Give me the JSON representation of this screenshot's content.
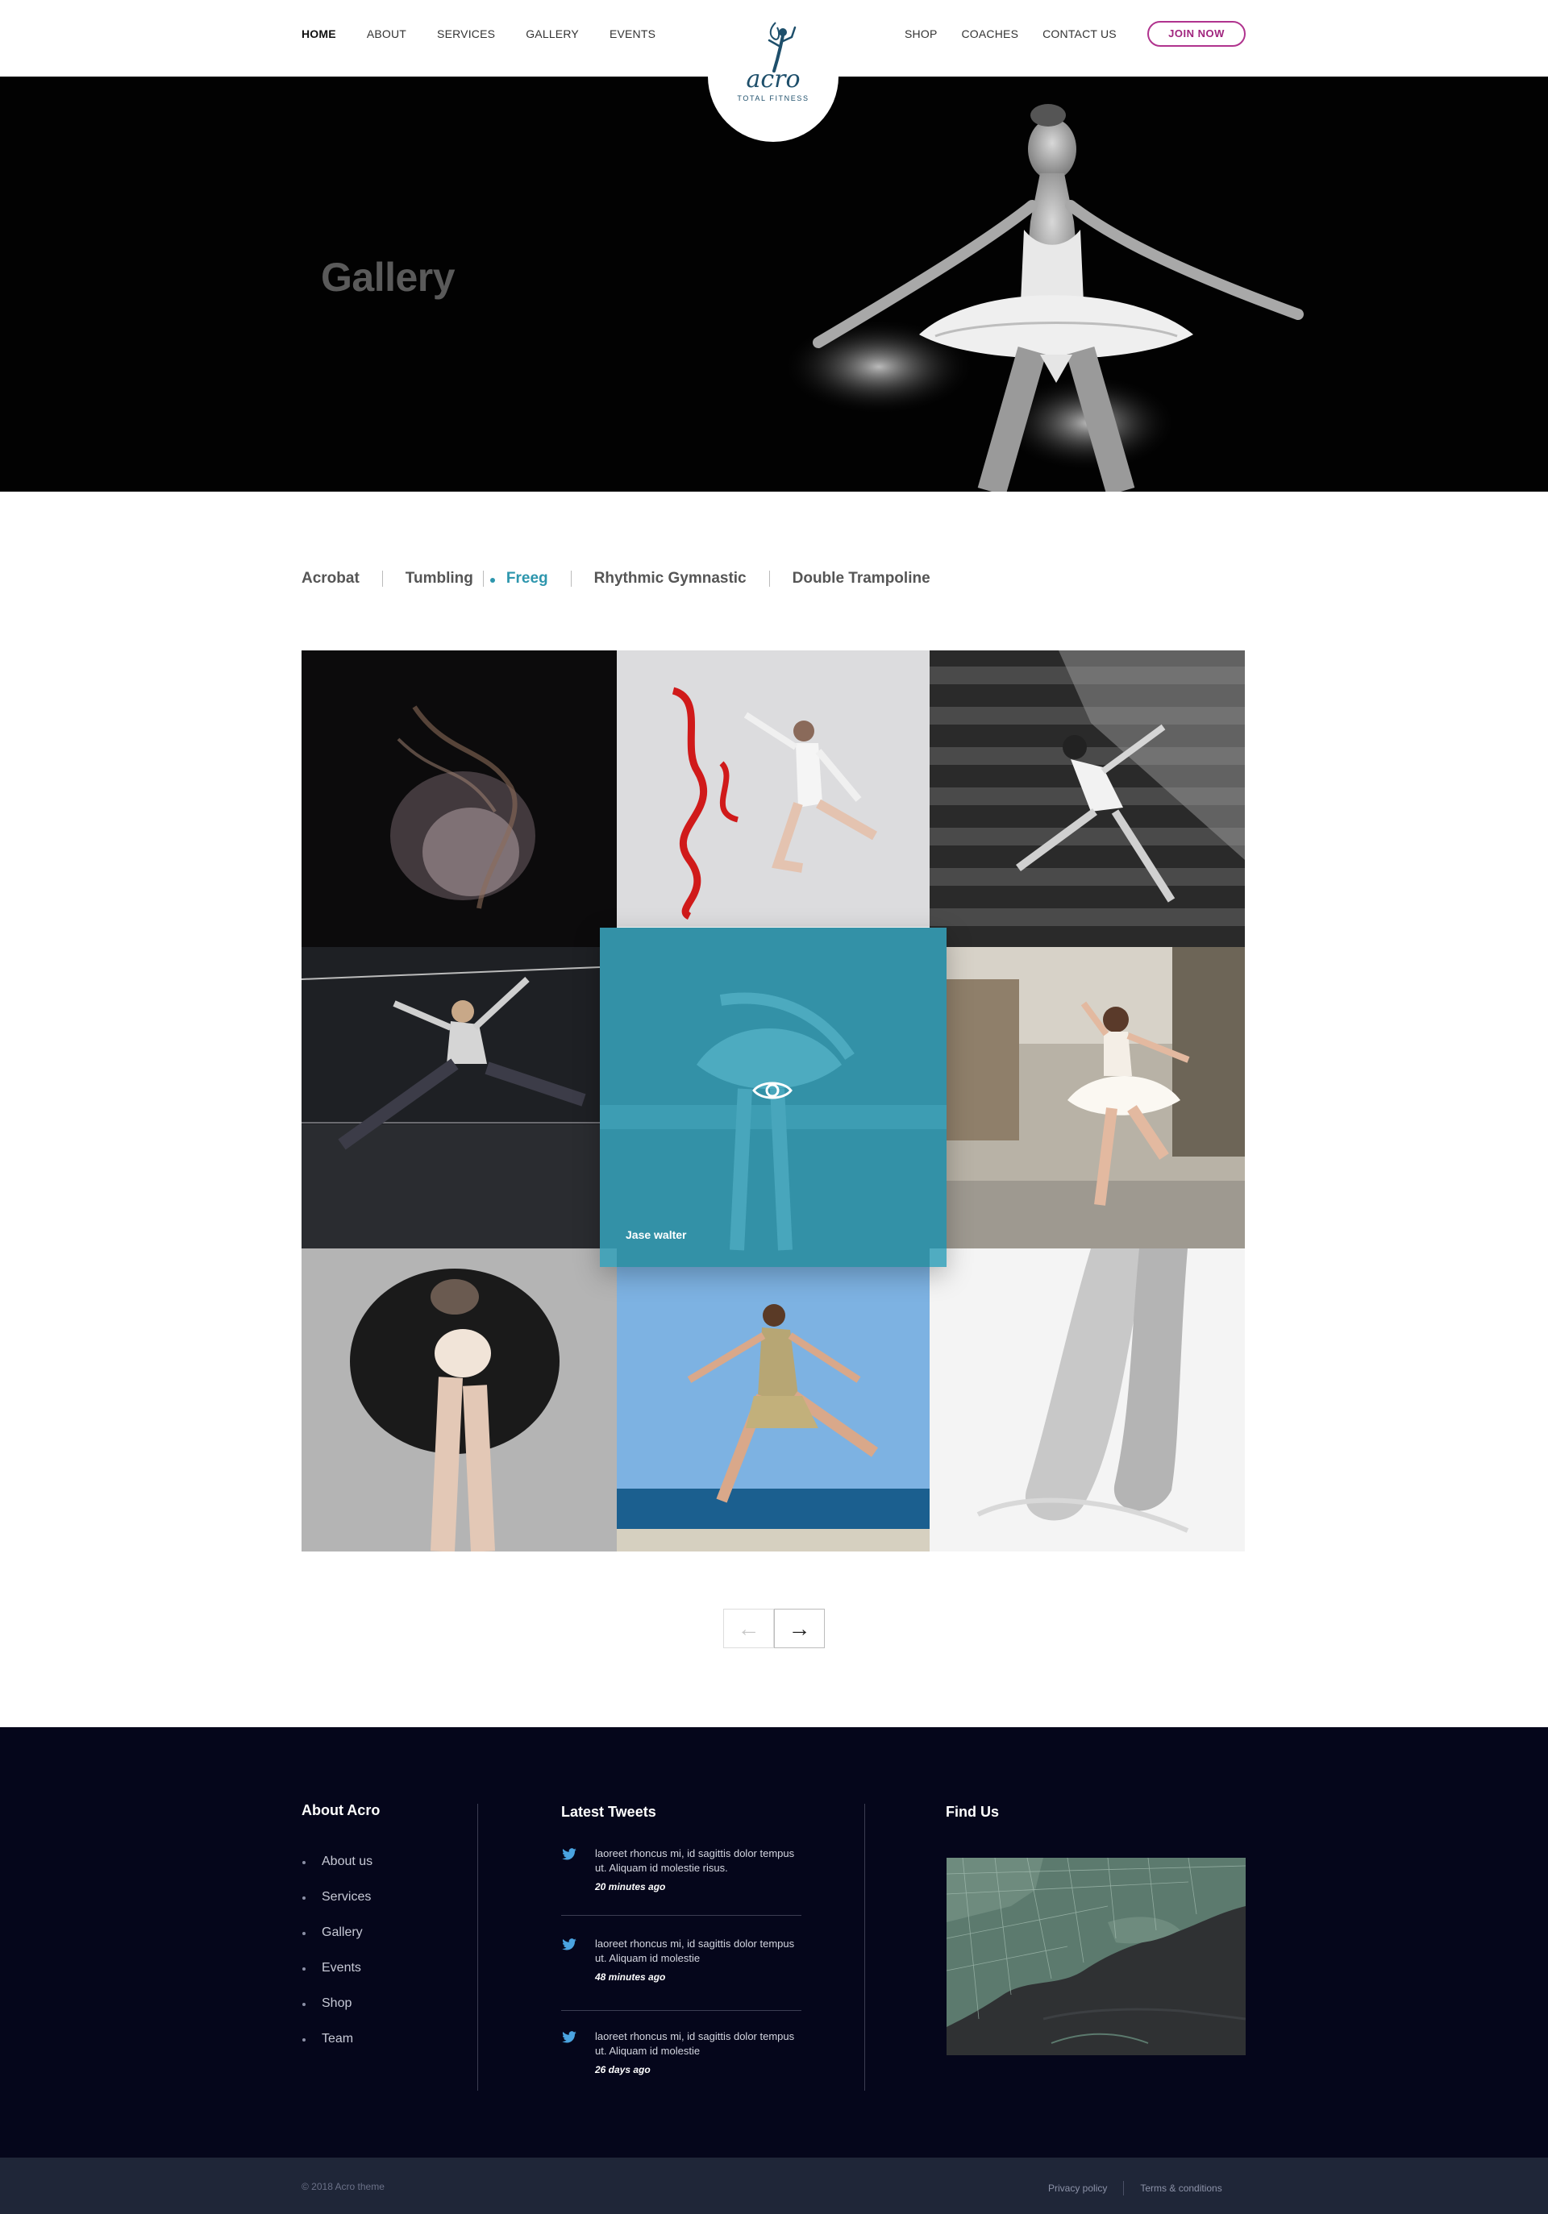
{
  "header": {
    "nav_left": [
      "HOME",
      "ABOUT",
      "SERVICES",
      "GALLERY",
      "EVENTS"
    ],
    "nav_right": [
      "SHOP",
      "COACHES",
      "CONTACT US"
    ],
    "join_label": "JOIN NOW",
    "logo_word": "acro",
    "logo_tagline": "TOTAL FITNESS"
  },
  "hero": {
    "title": "Gallery"
  },
  "filters": {
    "items": [
      "Acrobat",
      "Tumbling",
      "Freeg",
      "Rhythmic Gymnastic",
      "Double Trampoline"
    ],
    "active": "Freeg"
  },
  "gallery": {
    "overlay_name": "Jase walter",
    "overlay_icon": "eye-icon"
  },
  "pager": {
    "prev": "←",
    "next": "→"
  },
  "footer": {
    "about_title": "About Acro",
    "about_links": [
      "About us",
      "Services",
      "Gallery",
      "Events",
      "Shop",
      "Team"
    ],
    "tweets_title": "Latest Tweets",
    "tweets": [
      {
        "text": "laoreet rhoncus mi, id sagittis dolor tempus ut. Aliquam id molestie risus.",
        "time": "20 minutes ago"
      },
      {
        "text": "laoreet rhoncus mi, id sagittis dolor tempus ut. Aliquam id molestie",
        "time": "48 minutes ago"
      },
      {
        "text": "laoreet rhoncus mi, id sagittis dolor tempus ut. Aliquam id molestie",
        "time": "26 days ago"
      }
    ],
    "find_title": "Find Us"
  },
  "bottom": {
    "copyright": "© 2018 Acro theme",
    "privacy": "Privacy policy",
    "terms": "Terms & conditions"
  },
  "colors": {
    "accent": "#2d96ad",
    "brand": "#1e4f6b",
    "join": "#a0247d",
    "footer_bg": "#05061b",
    "bottom_bar_bg": "#1f2638"
  }
}
